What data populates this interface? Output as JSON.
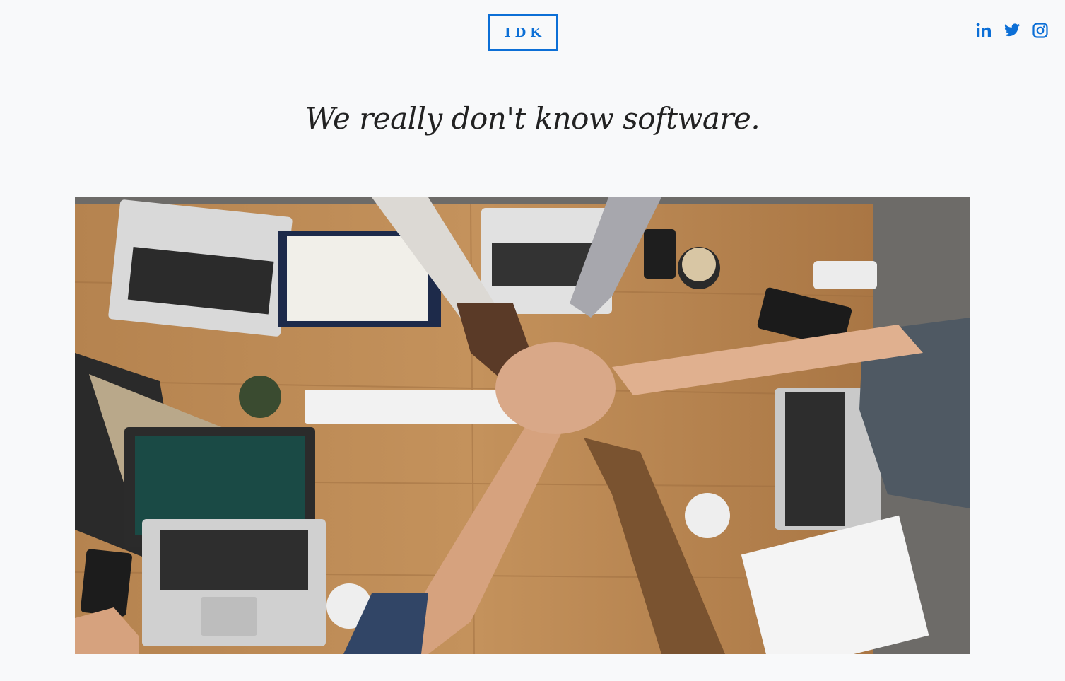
{
  "header": {
    "logo_text": "IDK",
    "social": [
      {
        "icon": "linkedin-icon",
        "label": "in"
      },
      {
        "icon": "twitter-icon"
      },
      {
        "icon": "instagram-icon"
      }
    ]
  },
  "hero": {
    "tagline": "We really don't know software."
  },
  "colors": {
    "accent": "#0c6fd6",
    "background": "#f8f9fa",
    "text": "#222222"
  }
}
